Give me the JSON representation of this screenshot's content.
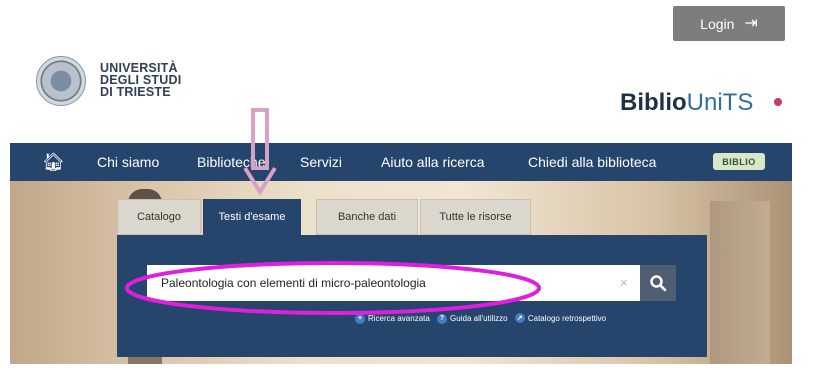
{
  "header": {
    "login_label": "Login",
    "login_icon": "sign-in-icon",
    "university_lines": [
      "UNIVERSITÀ",
      "DEGLI STUDI",
      "DI TRIESTE"
    ],
    "brand_part1": "Biblio",
    "brand_part2": "UniTS"
  },
  "nav": {
    "home_icon": "home-icon",
    "items": [
      "Chi siamo",
      "Biblioteche",
      "Servizi",
      "Aiuto alla ricerca",
      "Chiedi alla biblioteca"
    ],
    "badge": "BIBLIO"
  },
  "search": {
    "tabs": [
      "Catalogo",
      "Testi d'esame",
      "Banche dati",
      "Tutte le risorse"
    ],
    "active_tab": "Testi d'esame",
    "value": "Paleontologia con elementi di micro-paleontologia",
    "search_icon": "search-icon",
    "links": [
      {
        "icon": "plus-circle-icon",
        "label": "Ricerca avanzata"
      },
      {
        "icon": "question-circle-icon",
        "label": "Guida all'utilizzo"
      },
      {
        "icon": "external-link-icon",
        "label": "Catalogo retrospettivo"
      }
    ]
  },
  "colors": {
    "nav_bg": "#26456d",
    "annotation_arrow": "#d9a0c8",
    "annotation_ellipse": "#e01ee0",
    "brand_accent": "#2f6ea5"
  }
}
